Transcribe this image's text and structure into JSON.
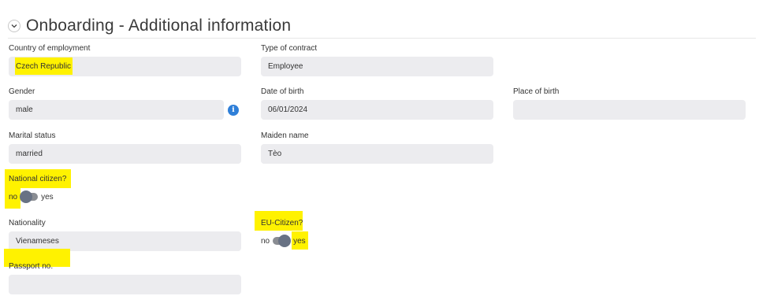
{
  "header": {
    "title": "Onboarding - Additional information"
  },
  "fields": {
    "country": {
      "label": "Country of employment",
      "value": "Czech Republic"
    },
    "contract": {
      "label": "Type of contract",
      "value": "Employee"
    },
    "gender": {
      "label": "Gender",
      "value": "male"
    },
    "dob": {
      "label": "Date of birth",
      "value": "06/01/2024"
    },
    "pob": {
      "label": "Place of birth",
      "value": ""
    },
    "marital": {
      "label": "Marital status",
      "value": "married"
    },
    "maiden": {
      "label": "Maiden name",
      "value": "Tèo"
    },
    "nationality": {
      "label": "Nationality",
      "value": "Vienameses"
    },
    "passport": {
      "label": "Passport no.",
      "value": ""
    }
  },
  "toggles": {
    "national": {
      "label": "National citizen?",
      "off": "no",
      "on": "yes",
      "state": "no"
    },
    "eu": {
      "label": "EU-Citizen?",
      "off": "no",
      "on": "yes",
      "state": "yes"
    }
  },
  "icons": {
    "info": "info-icon",
    "chevron": "chevron-down-icon"
  },
  "colors": {
    "highlight": "#fff200",
    "field_bg": "#ececef",
    "info_blue": "#2f7fd8"
  }
}
